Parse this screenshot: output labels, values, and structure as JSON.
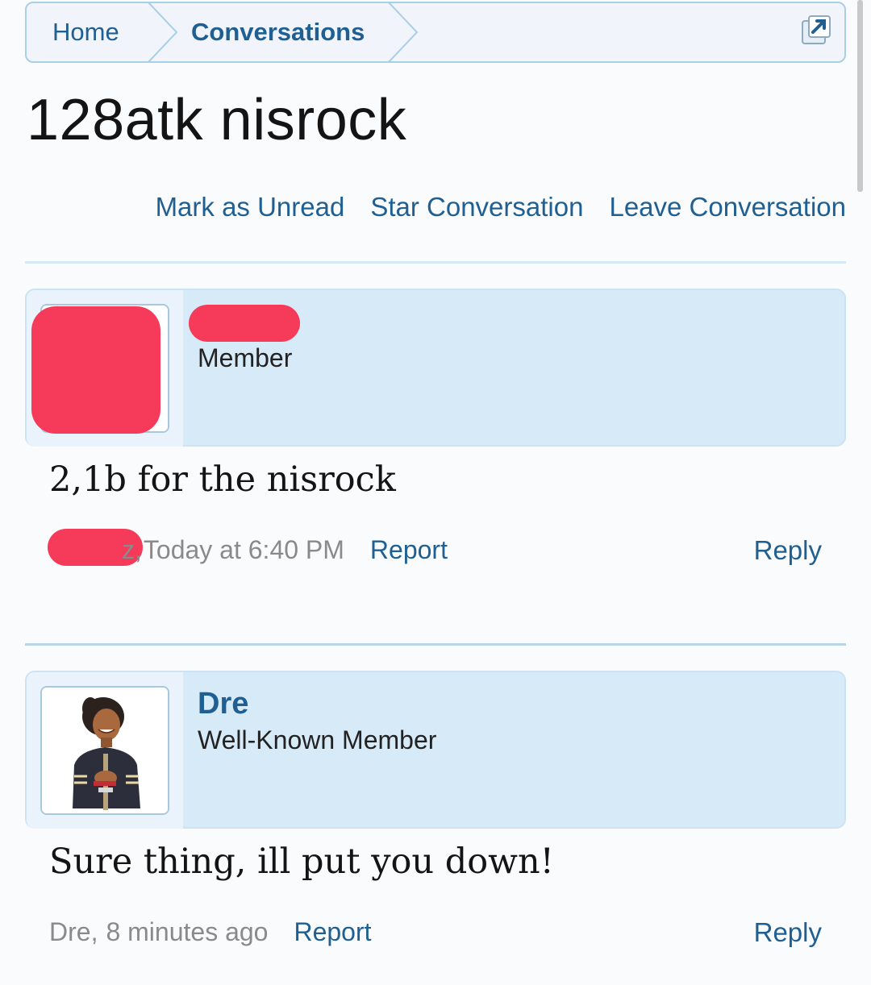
{
  "breadcrumb": {
    "items": [
      {
        "label": "Home"
      },
      {
        "label": "Conversations"
      }
    ],
    "jump_icon": "external-link-icon"
  },
  "page": {
    "title": "128atk nisrock"
  },
  "actions": {
    "mark_unread": "Mark as Unread",
    "star": "Star Conversation",
    "leave": "Leave Conversation"
  },
  "messages": [
    {
      "username": "",
      "user_title": "Member",
      "body": "2,1b for the nisrock",
      "author_suffix": "z,",
      "date": "Today at 6:40 PM",
      "report": "Report",
      "reply": "Reply"
    },
    {
      "username": "Dre",
      "user_title": "Well-Known Member",
      "body": "Sure thing, ill put you down!",
      "author_suffix": "Dre,",
      "date": "8 minutes ago",
      "report": "Report",
      "reply": "Reply"
    }
  ],
  "colors": {
    "link": "#1f5f91",
    "header_bg": "#d7eaf8",
    "redaction": "#f53a5a"
  }
}
